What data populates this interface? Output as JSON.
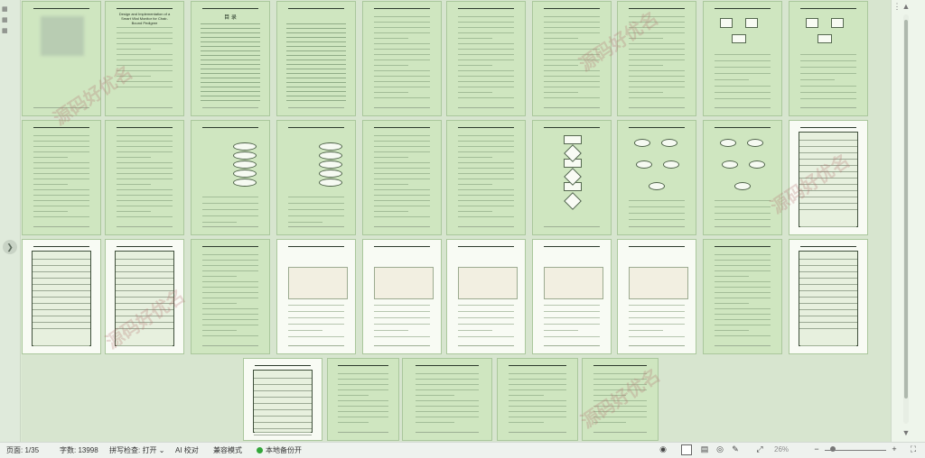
{
  "status_bar": {
    "page": "页面: 1/35",
    "word_count": "字数: 13998",
    "spell_check": "拼写检查: 打开",
    "spell_arrow": "⌄",
    "ai_check": "AI 校对",
    "compat": "兼容模式",
    "backup": "本地备份开",
    "zoom": "26%",
    "zoom_level": 0.26
  },
  "document_preview": {
    "title_text": "Design and Implementation of a Smart Vital Monitor for Chair-Bound Pedigree",
    "toc_label": "目 录",
    "watermark": "源码好优名"
  },
  "colors": {
    "background": "#dce9d4",
    "page_green": "#cfe6c0",
    "page_white": "#f8fbf4",
    "backup_green": "#33a63a"
  },
  "icons": {
    "collapse": "right-chevron-icon",
    "eye": "eye-icon",
    "doc_page": "page-view-icon",
    "split": "split-view-icon",
    "web": "globe-icon",
    "pen": "edit-icon",
    "fit": "fit-page-icon",
    "zoom_out": "minus-icon",
    "zoom_in": "plus-icon",
    "fullscreen": "fullscreen-icon",
    "more": "more-icon"
  }
}
